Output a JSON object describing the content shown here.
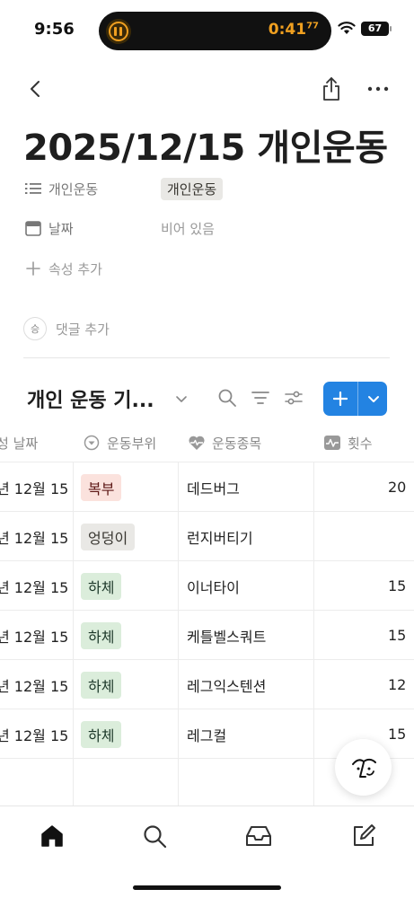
{
  "status_bar": {
    "time": "9:56",
    "timer": "0:41",
    "timer_fraction": "77",
    "battery": "67"
  },
  "page": {
    "title": "2025/12/15 개인운동"
  },
  "properties": [
    {
      "icon": "list-icon",
      "label": "개인운동",
      "value": "개인운동",
      "value_type": "tag"
    },
    {
      "icon": "calendar-icon",
      "label": "날짜",
      "value": "비어 있음",
      "value_type": "empty"
    }
  ],
  "add_property": "속성 추가",
  "comment": {
    "avatar": "승",
    "label": "댓글 추가"
  },
  "database": {
    "title": "개인 운동 기...",
    "columns": [
      {
        "icon": "calendar-icon",
        "label": "성 날짜"
      },
      {
        "icon": "select-icon",
        "label": "운동부위"
      },
      {
        "icon": "heart-pulse-icon",
        "label": "운동종목"
      },
      {
        "icon": "number-icon",
        "label": "횟수"
      }
    ],
    "rows": [
      {
        "date": "년 12월 15",
        "part": "복부",
        "part_color": "red",
        "exercise": "데드버그",
        "reps": "20"
      },
      {
        "date": "년 12월 15",
        "part": "엉덩이",
        "part_color": "gray",
        "exercise": "런지버티기",
        "reps": ""
      },
      {
        "date": "년 12월 15",
        "part": "하체",
        "part_color": "green",
        "exercise": "이너타이",
        "reps": "15"
      },
      {
        "date": "년 12월 15",
        "part": "하체",
        "part_color": "green",
        "exercise": "케틀벨스쿼트",
        "reps": "15"
      },
      {
        "date": "년 12월 15",
        "part": "하체",
        "part_color": "green",
        "exercise": "레그익스텐션",
        "reps": "12"
      },
      {
        "date": "년 12월 15",
        "part": "하체",
        "part_color": "green",
        "exercise": "레그컬",
        "reps": "15"
      }
    ]
  },
  "colors": {
    "accent": "#2383e2",
    "tag_red_bg": "#fbe2dd",
    "tag_green_bg": "#dbeddb",
    "tag_gray_bg": "#e9e8e5"
  },
  "tab_bar": [
    {
      "icon": "home-icon",
      "active": true
    },
    {
      "icon": "search-icon",
      "active": false
    },
    {
      "icon": "inbox-icon",
      "active": false
    },
    {
      "icon": "compose-icon",
      "active": false
    }
  ]
}
